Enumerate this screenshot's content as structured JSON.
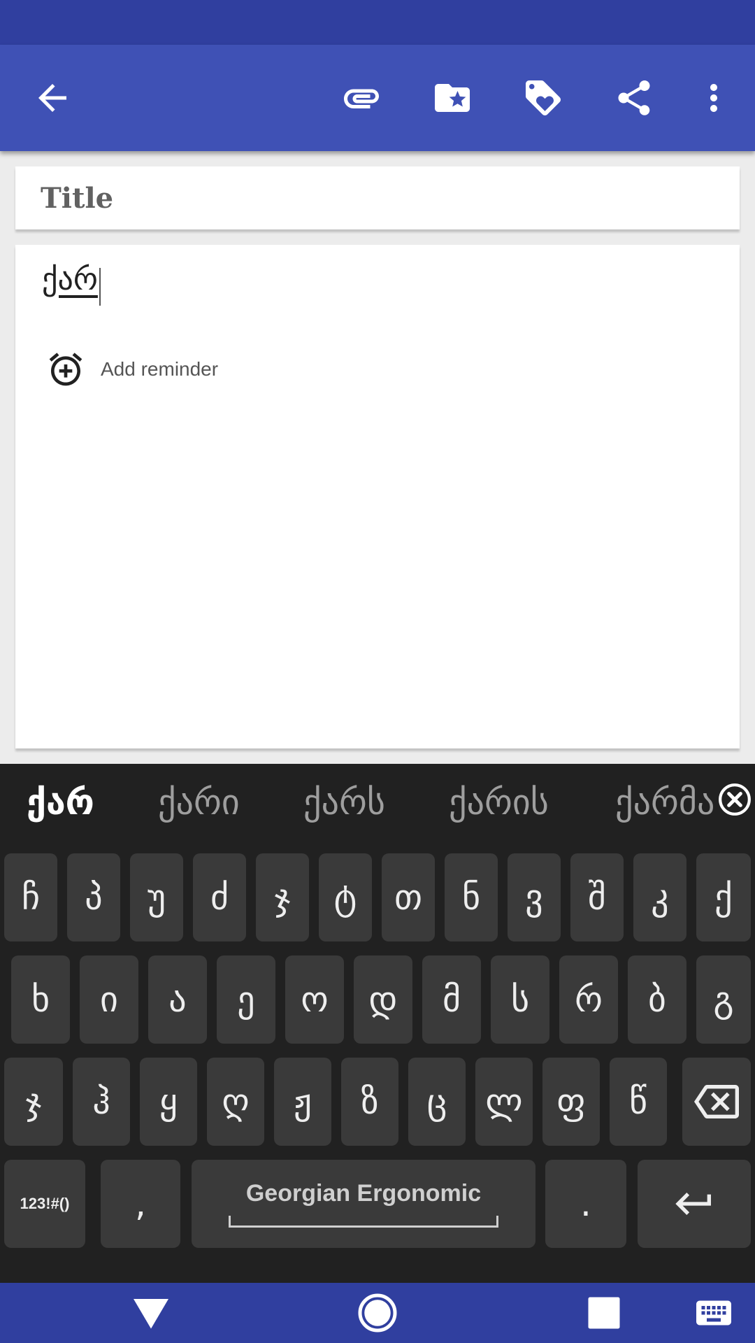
{
  "app": {
    "toolbar_icons": [
      "back-arrow-icon",
      "paperclip-icon",
      "folder-star-icon",
      "tag-heart-icon",
      "share-icon",
      "more-vert-icon"
    ]
  },
  "note": {
    "title_placeholder": "Title",
    "content": "ქარ",
    "add_reminder": "Add reminder"
  },
  "keyboard": {
    "suggestions": [
      "ქარ",
      "ქარი",
      "ქარს",
      "ქარის",
      "ქარმა"
    ],
    "rows": [
      [
        "ჩ",
        "პ",
        "უ",
        "ძ",
        "ჯ",
        "ტ",
        "თ",
        "ნ",
        "ვ",
        "შ",
        "კ",
        "ქ"
      ],
      [
        "ხ",
        "ი",
        "ა",
        "ე",
        "ო",
        "დ",
        "მ",
        "ს",
        "რ",
        "ბ",
        "გ"
      ],
      [
        "ჯ",
        "ჰ",
        "ყ",
        "ღ",
        "ჟ",
        "ზ",
        "ც",
        "ლ",
        "ფ",
        "წ"
      ]
    ],
    "symbols_label": "123!#()",
    "comma": ",",
    "space_label": "Georgian Ergonomic",
    "period": "."
  },
  "colors": {
    "primary": "#3f51b5",
    "primary_dark": "#303f9f",
    "keyboard_bg": "#212121",
    "key_bg": "#3a3a3a"
  }
}
